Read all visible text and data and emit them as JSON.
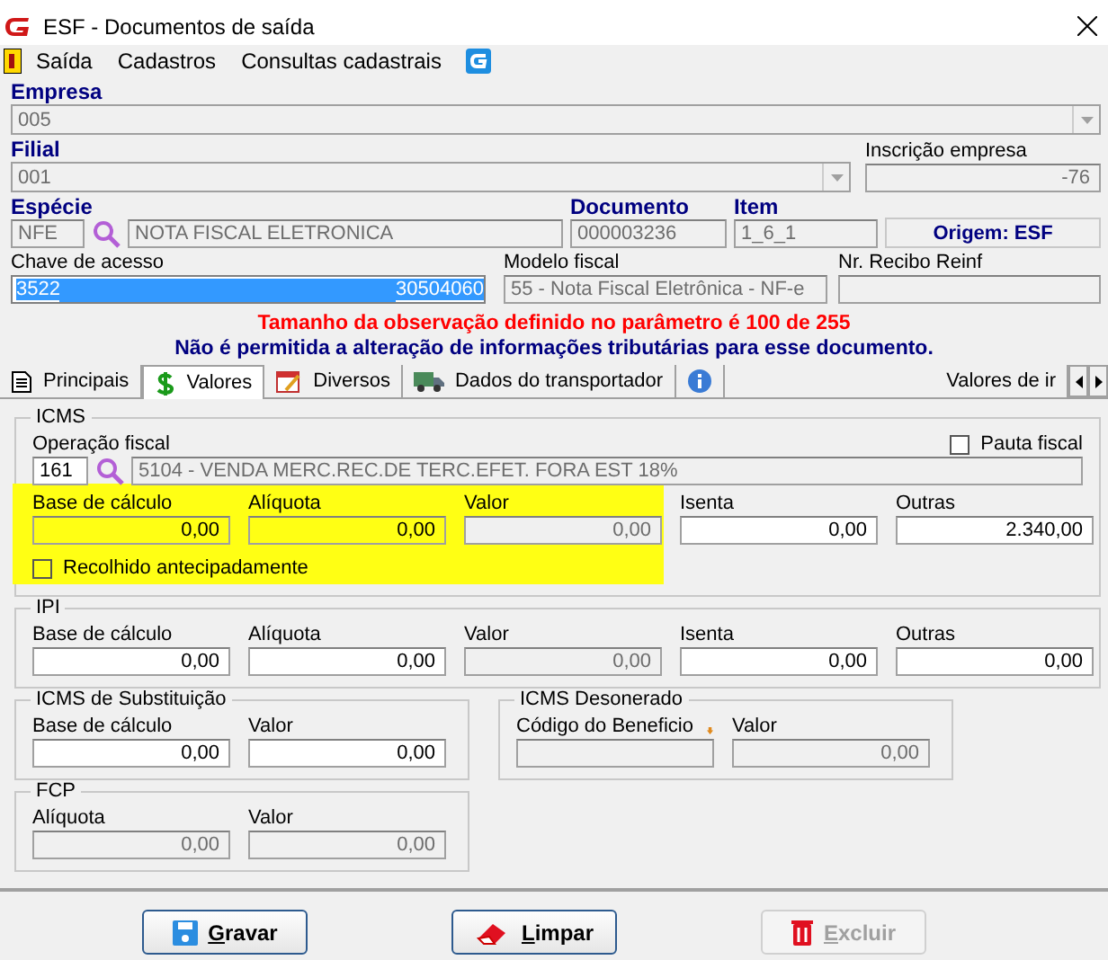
{
  "window": {
    "title": "ESF - Documentos de saída"
  },
  "menu": [
    {
      "label": "Saída"
    },
    {
      "label": "Cadastros"
    },
    {
      "label": "Consultas cadastrais"
    }
  ],
  "header": {
    "empresa": {
      "label": "Empresa",
      "value": "005"
    },
    "filial": {
      "label": "Filial",
      "value": "001"
    },
    "inscricao": {
      "label": "Inscrição empresa",
      "value": "-76"
    },
    "especie": {
      "label": "Espécie",
      "code": "NFE",
      "description": "NOTA FISCAL ELETRONICA"
    },
    "documento": {
      "label": "Documento",
      "value": "000003236"
    },
    "item": {
      "label": "Item",
      "value": "1_6_1"
    },
    "origem": "Origem: ESF",
    "chave": {
      "label": "Chave de acesso",
      "value_start": "3522",
      "value_end": "30504060"
    },
    "modelo": {
      "label": "Modelo fiscal",
      "value": "55 - Nota Fiscal Eletrônica - NF-e"
    },
    "recibo": {
      "label": "Nr. Recibo Reinf"
    }
  },
  "messages": [
    {
      "text": "Tamanho da observação definido no parâmetro é 100 de 255",
      "color": "#ff0000"
    },
    {
      "text": "Não é permitida a alteração de informações tributárias para esse documento.",
      "color": "#000080"
    }
  ],
  "tabs": [
    {
      "label": "Principais",
      "selected": false
    },
    {
      "label": "Valores",
      "selected": true
    },
    {
      "label": "Diversos",
      "selected": false
    },
    {
      "label": "Dados do transportador",
      "selected": false
    },
    {
      "selected": false
    },
    {
      "label": "Valores de ir",
      "selected": false
    }
  ],
  "icms": {
    "title": "ICMS",
    "highlighted": true,
    "operacao": {
      "label": "Operação fiscal",
      "code": "161",
      "description": "5104 - VENDA  MERC.REC.DE TERC.EFET. FORA EST 18%"
    },
    "pauta": {
      "label": "Pauta fiscal",
      "checked": false
    },
    "fields": [
      {
        "label": "Base de cálculo",
        "value": "0,00",
        "disabled": false
      },
      {
        "label": "Alíquota",
        "value": "0,00",
        "disabled": false
      },
      {
        "label": "Valor",
        "value": "0,00",
        "disabled": true
      },
      {
        "label": "Isenta",
        "value": "0,00",
        "disabled": false
      },
      {
        "label": "Outras",
        "value": "2.340,00",
        "disabled": false
      }
    ],
    "recolhido": {
      "label": "Recolhido antecipadamente",
      "checked": false
    }
  },
  "ipi": {
    "title": "IPI",
    "fields": [
      {
        "label": "Base de cálculo",
        "value": "0,00",
        "disabled": false
      },
      {
        "label": "Alíquota",
        "value": "0,00",
        "disabled": false
      },
      {
        "label": "Valor",
        "value": "0,00",
        "disabled": true
      },
      {
        "label": "Isenta",
        "value": "0,00",
        "disabled": false
      },
      {
        "label": "Outras",
        "value": "0,00",
        "disabled": false
      }
    ]
  },
  "icms_st": {
    "title": "ICMS de Substituição",
    "fields": [
      {
        "label": "Base de cálculo",
        "value": "0,00",
        "disabled": false
      },
      {
        "label": "Valor",
        "value": "0,00",
        "disabled": false
      }
    ]
  },
  "icms_desonerado": {
    "title": "ICMS Desonerado",
    "fields": [
      {
        "label": "Código do Beneficio",
        "disabled": true,
        "kind": "lookup"
      },
      {
        "label": "Valor",
        "value": "0,00",
        "disabled": true
      }
    ]
  },
  "fcp": {
    "title": "FCP",
    "fields": [
      {
        "label": "Alíquota",
        "value": "0,00",
        "disabled": true
      },
      {
        "label": "Valor",
        "value": "0,00",
        "disabled": true
      }
    ]
  },
  "buttons": [
    {
      "label": "Gravar",
      "disabled": false
    },
    {
      "label": "Limpar",
      "disabled": false
    },
    {
      "label": "Excluir",
      "disabled": true
    }
  ]
}
